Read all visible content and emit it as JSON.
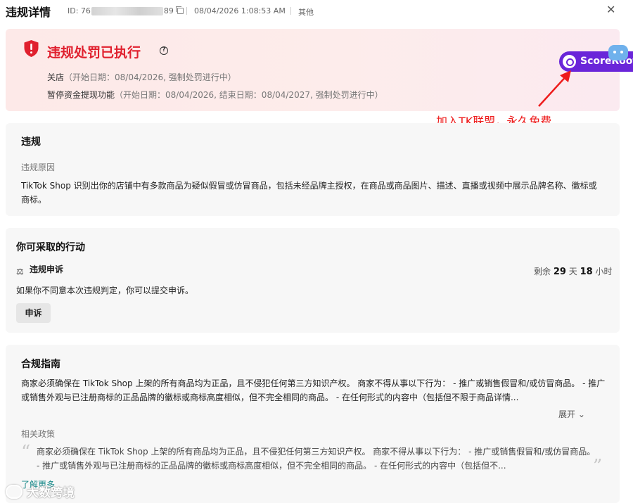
{
  "header": {
    "title": "违规详情",
    "id_prefix": "ID: 76",
    "id_suffix": "89",
    "datetime": "08/04/2026 1:08:53 AM",
    "other_label": "其他",
    "close_icon": "close-icon"
  },
  "alert": {
    "title": "违规处罚已执行",
    "help_icon": "?",
    "penalty1_name": "关店",
    "penalty1_detail": "（开始日期：08/04/2026, 强制处罚进行中）",
    "penalty2_name": "暂停资金提现功能",
    "penalty2_detail": "（开始日期：08/04/2026, 结束日期：08/04/2027, 强制处罚进行中）",
    "accent_color": "#e0202e"
  },
  "score_button": {
    "label": "ScoreRoot"
  },
  "promo_text": "加入TK联盟，永久免费使用该达人建联工具",
  "violation": {
    "title": "违规",
    "reason_label": "违规原因",
    "reason_text": "TikTok Shop 识别出你的店铺中有多款商品为疑似假冒或仿冒商品，包括未经品牌主授权，在商品或商品图片、描述、直播或视频中展示品牌名称、徽标或商标。"
  },
  "actions": {
    "title": "你可采取的行动",
    "appeal_title": "违规申诉",
    "remaining_prefix": "剩余",
    "remaining_days": "29",
    "days_unit": "天",
    "remaining_hours": "18",
    "hours_unit": "小时",
    "appeal_desc": "如果你不同意本次违规判定，你可以提交申诉。",
    "appeal_button": "申诉"
  },
  "guide": {
    "title": "合规指南",
    "text": "商家必须确保在 TikTok Shop 上架的所有商品均为正品，且不侵犯任何第三方知识产权。 商家不得从事以下行为： - 推广或销售假冒和/或仿冒商品。 - 推广或销售外观与已注册商标的正品品牌的徽标或商标高度相似，但不完全相同的商品。 - 在任何形式的内容中（包括但不限于商品详情...",
    "expand_label": "展开",
    "related_label": "相关政策",
    "quote_text": "商家必须确保在 TikTok Shop 上架的所有商品均为正品，且不侵犯任何第三方知识产权。 商家不得从事以下行为： - 推广或销售假冒和/或仿冒商品。 - 推广或销售外观与已注册商标的正品品牌的徽标或商标高度相似，但不完全相同的商品。 - 在任何形式的内容中（包括但不...",
    "learn_more": "了解更多"
  },
  "watermark": "大数跨境"
}
